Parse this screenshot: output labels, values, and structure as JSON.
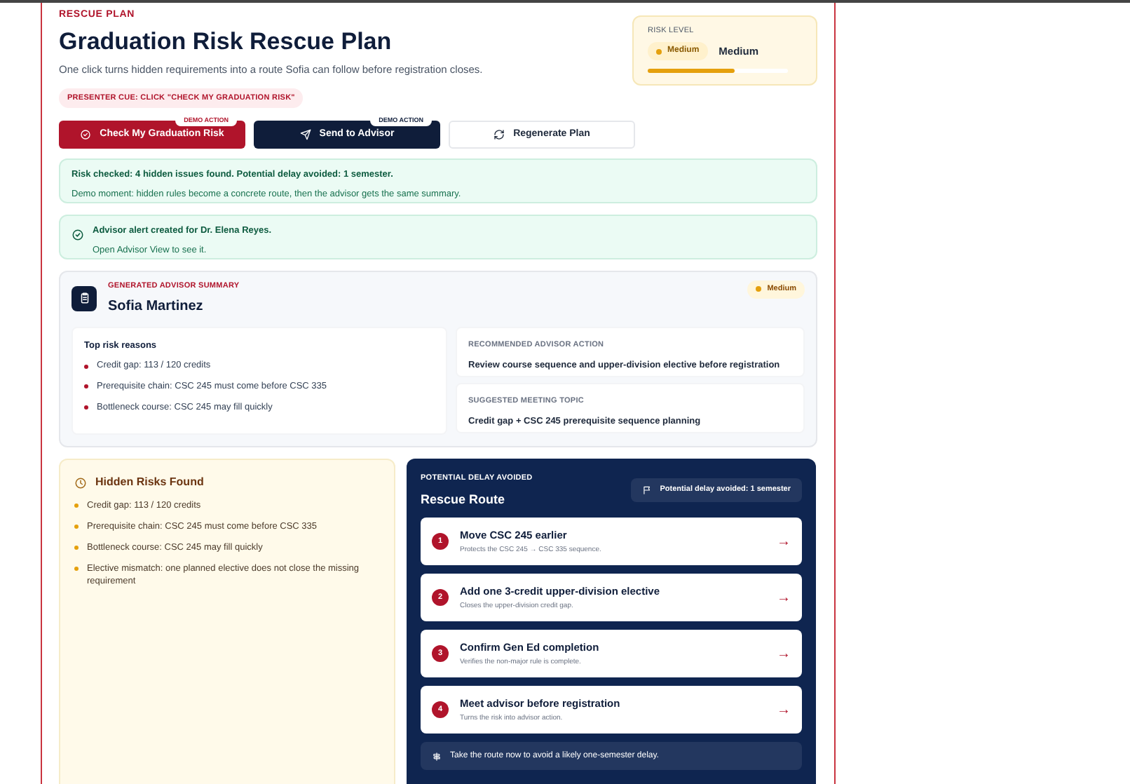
{
  "eyebrow": "RESCUE PLAN",
  "title": "Graduation Risk Rescue Plan",
  "subtitle": "One click turns hidden requirements into a route Sofia can follow before registration closes.",
  "presenter_cue": "PRESENTER CUE: CLICK \"CHECK MY GRADUATION RISK\"",
  "risk_level": {
    "label": "RISK LEVEL",
    "badge": "Medium",
    "value": "Medium",
    "level": 0.62
  },
  "actions": [
    {
      "kind": "primary",
      "label": "Check My Graduation Risk",
      "tag": "DEMO ACTION"
    },
    {
      "kind": "dark",
      "label": "Send to Advisor",
      "tag": "DEMO ACTION"
    },
    {
      "kind": "outline",
      "label": "Regenerate Plan"
    }
  ],
  "risk_alert": {
    "headline": "Risk checked: 4 hidden issues found. Potential delay avoided: 1 semester.",
    "detail": "Demo moment: hidden rules become a concrete route, then the advisor gets the same summary."
  },
  "advisor_alert": {
    "headline": "Advisor alert created for Dr. Elena Reyes.",
    "detail": "Open Advisor View to see it."
  },
  "summary": {
    "eyebrow": "GENERATED ADVISOR SUMMARY",
    "student": "Sofia Martinez",
    "badge": "Medium",
    "reasons_title": "Top risk reasons",
    "reasons": [
      "Credit gap: 113 / 120 credits",
      "Prerequisite chain: CSC 245 must come before CSC 335",
      "Bottleneck course: CSC 245 may fill quickly"
    ],
    "panels": [
      {
        "label": "RECOMMENDED ADVISOR ACTION",
        "text": "Review course sequence and upper-division elective before registration"
      },
      {
        "label": "SUGGESTED MEETING TOPIC",
        "text": "Credit gap + CSC 245 prerequisite sequence planning"
      }
    ]
  },
  "hidden_risks": {
    "title": "Hidden Risks Found",
    "items": [
      "Credit gap: 113 / 120 credits",
      "Prerequisite chain: CSC 245 must come before CSC 335",
      "Bottleneck course: CSC 245 may fill quickly",
      "Elective mismatch: one planned elective does not close the missing requirement"
    ]
  },
  "route": {
    "eyebrow": "POTENTIAL DELAY AVOIDED",
    "title": "Rescue Route",
    "chip": "Potential delay avoided: 1 semester",
    "steps": [
      {
        "number": "1",
        "title": "Move CSC 245 earlier",
        "detail": "Protects the CSC 245 → CSC 335 sequence.",
        "arrow": "→"
      },
      {
        "number": "2",
        "title": "Add one 3-credit upper-division elective",
        "detail": "Closes the upper-division credit gap.",
        "arrow": "→"
      },
      {
        "number": "3",
        "title": "Confirm Gen Ed completion",
        "detail": "Verifies the non-major rule is complete.",
        "arrow": "→"
      },
      {
        "number": "4",
        "title": "Meet advisor before registration",
        "detail": "Turns the risk into advisor action.",
        "arrow": "→"
      }
    ],
    "footer": "Take the route now to avoid a likely one-semester delay."
  }
}
